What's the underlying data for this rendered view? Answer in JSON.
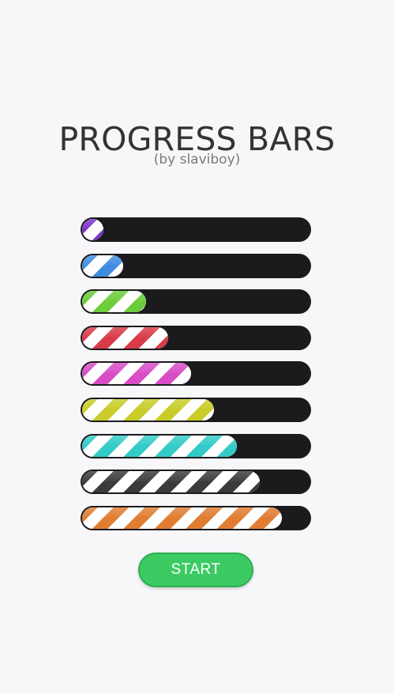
{
  "header": {
    "title": "PROGRESS BARS",
    "subtitle": "(by slaviboy)"
  },
  "progress_bars": [
    {
      "color": "#7b35c9",
      "progress_percent": 8
    },
    {
      "color": "#3f8de0",
      "progress_percent": 18
    },
    {
      "color": "#6ccc3a",
      "progress_percent": 28
    },
    {
      "color": "#d93b49",
      "progress_percent": 38
    },
    {
      "color": "#d84cc6",
      "progress_percent": 48
    },
    {
      "color": "#c9cc2a",
      "progress_percent": 58
    },
    {
      "color": "#33cbc6",
      "progress_percent": 68
    },
    {
      "color": "#3b3b3b",
      "progress_percent": 78
    },
    {
      "color": "#e07d33",
      "progress_percent": 88
    }
  ],
  "actions": {
    "start_label": "START",
    "start_color": "#3ccb63"
  }
}
